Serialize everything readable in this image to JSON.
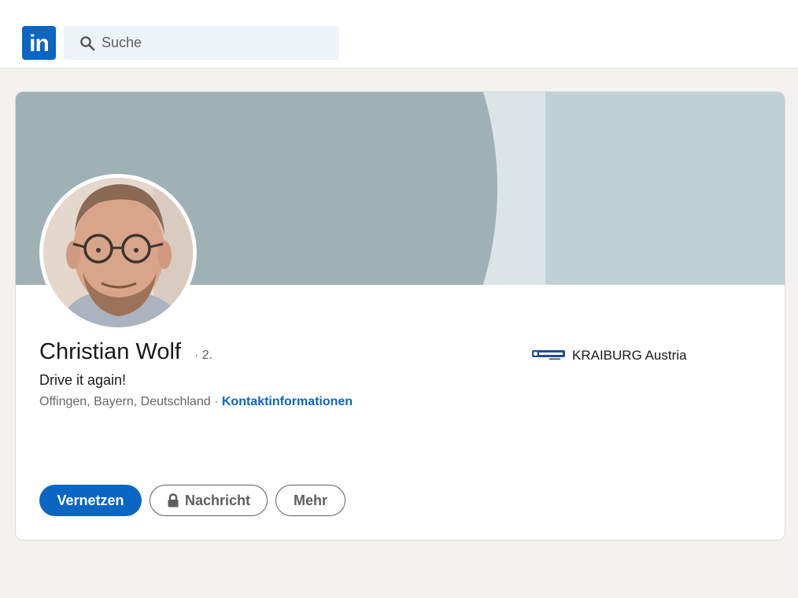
{
  "header": {
    "logo_text": "in",
    "search": {
      "placeholder": "Suche",
      "value": ""
    }
  },
  "profile": {
    "name": "Christian Wolf",
    "connection_degree": "· 2.",
    "headline": "Drive it again!",
    "location": "Offingen, Bayern, Deutschland",
    "separator": "·",
    "contact_link": "Kontaktinformationen",
    "company": {
      "name": "KRAIBURG Austria",
      "logo_icon": "kraiburg-logo"
    }
  },
  "actions": {
    "connect": "Vernetzen",
    "message": "Nachricht",
    "more": "Mehr"
  },
  "colors": {
    "brand": "#0a66c2",
    "background": "#f3f2ef",
    "banner_dark": "#9fb1b5",
    "banner_light": "#c0d1d5"
  }
}
